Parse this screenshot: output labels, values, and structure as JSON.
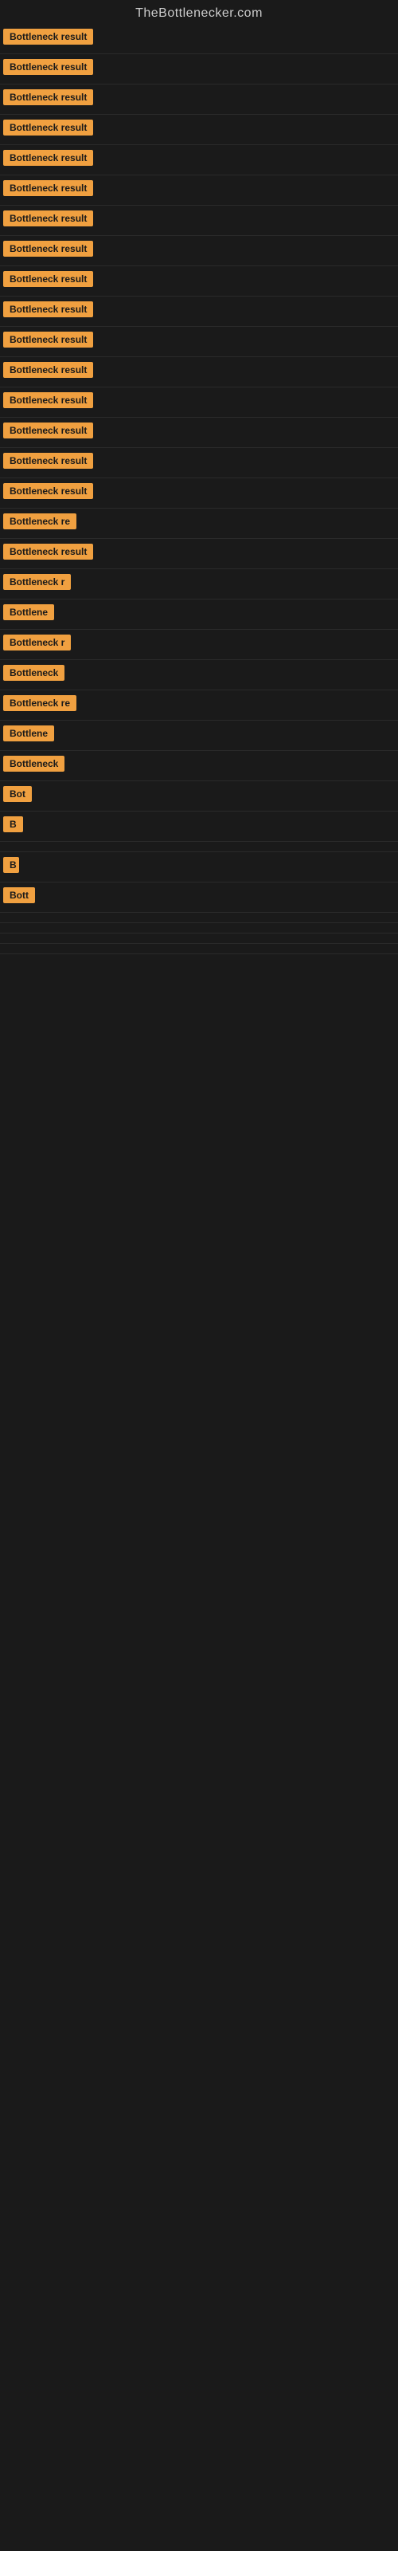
{
  "site": {
    "title": "TheBottlenecker.com"
  },
  "rows": [
    {
      "id": 1,
      "label": "Bottleneck result",
      "width": 130
    },
    {
      "id": 2,
      "label": "Bottleneck result",
      "width": 130
    },
    {
      "id": 3,
      "label": "Bottleneck result",
      "width": 130
    },
    {
      "id": 4,
      "label": "Bottleneck result",
      "width": 130
    },
    {
      "id": 5,
      "label": "Bottleneck result",
      "width": 130
    },
    {
      "id": 6,
      "label": "Bottleneck result",
      "width": 130
    },
    {
      "id": 7,
      "label": "Bottleneck result",
      "width": 130
    },
    {
      "id": 8,
      "label": "Bottleneck result",
      "width": 130
    },
    {
      "id": 9,
      "label": "Bottleneck result",
      "width": 130
    },
    {
      "id": 10,
      "label": "Bottleneck result",
      "width": 130
    },
    {
      "id": 11,
      "label": "Bottleneck result",
      "width": 130
    },
    {
      "id": 12,
      "label": "Bottleneck result",
      "width": 130
    },
    {
      "id": 13,
      "label": "Bottleneck result",
      "width": 130
    },
    {
      "id": 14,
      "label": "Bottleneck result",
      "width": 130
    },
    {
      "id": 15,
      "label": "Bottleneck result",
      "width": 130
    },
    {
      "id": 16,
      "label": "Bottleneck result",
      "width": 130
    },
    {
      "id": 17,
      "label": "Bottleneck re",
      "width": 110
    },
    {
      "id": 18,
      "label": "Bottleneck result",
      "width": 128
    },
    {
      "id": 19,
      "label": "Bottleneck r",
      "width": 100
    },
    {
      "id": 20,
      "label": "Bottlene",
      "width": 80
    },
    {
      "id": 21,
      "label": "Bottleneck r",
      "width": 100
    },
    {
      "id": 22,
      "label": "Bottleneck",
      "width": 90
    },
    {
      "id": 23,
      "label": "Bottleneck re",
      "width": 110
    },
    {
      "id": 24,
      "label": "Bottlene",
      "width": 80
    },
    {
      "id": 25,
      "label": "Bottleneck",
      "width": 88
    },
    {
      "id": 26,
      "label": "Bot",
      "width": 50
    },
    {
      "id": 27,
      "label": "B",
      "width": 28
    },
    {
      "id": 28,
      "label": "",
      "width": 0
    },
    {
      "id": 29,
      "label": "B",
      "width": 20
    },
    {
      "id": 30,
      "label": "Bott",
      "width": 48
    },
    {
      "id": 31,
      "label": "",
      "width": 0
    },
    {
      "id": 32,
      "label": "",
      "width": 0
    },
    {
      "id": 33,
      "label": "",
      "width": 0
    },
    {
      "id": 34,
      "label": "",
      "width": 0
    },
    {
      "id": 35,
      "label": "",
      "width": 0
    }
  ]
}
